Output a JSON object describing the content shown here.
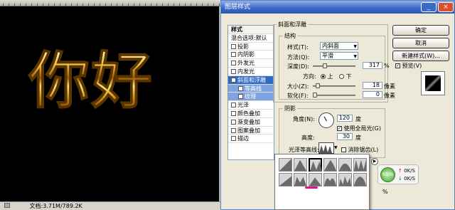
{
  "canvas": {
    "text": "你好",
    "status": "文档:3.71M/789.2K"
  },
  "dialog": {
    "title": "图层样式",
    "left_list": [
      {
        "label": "样式",
        "checkbox": false,
        "style": "header"
      },
      {
        "label": "混合选项:默认",
        "checkbox": false,
        "style": "normal"
      },
      {
        "label": "投影",
        "checkbox": true,
        "checked": false,
        "style": "normal"
      },
      {
        "label": "内阴影",
        "checkbox": true,
        "checked": false,
        "style": "normal"
      },
      {
        "label": "外发光",
        "checkbox": true,
        "checked": false,
        "style": "normal"
      },
      {
        "label": "内发光",
        "checkbox": true,
        "checked": false,
        "style": "normal"
      },
      {
        "label": "斜面和浮雕",
        "checkbox": true,
        "checked": true,
        "style": "sel"
      },
      {
        "label": "等高线",
        "checkbox": true,
        "checked": false,
        "style": "sub"
      },
      {
        "label": "纹理",
        "checkbox": true,
        "checked": false,
        "style": "sub"
      },
      {
        "label": "光泽",
        "checkbox": true,
        "checked": false,
        "style": "normal"
      },
      {
        "label": "颜色叠加",
        "checkbox": true,
        "checked": false,
        "style": "normal"
      },
      {
        "label": "渐变叠加",
        "checkbox": true,
        "checked": false,
        "style": "normal"
      },
      {
        "label": "图案叠加",
        "checkbox": true,
        "checked": false,
        "style": "normal"
      },
      {
        "label": "描边",
        "checkbox": true,
        "checked": false,
        "style": "normal"
      }
    ],
    "bevel": {
      "group_title": "斜面和浮雕",
      "structure_title": "结构",
      "style_label": "样式(T):",
      "style_value": "内斜面",
      "method_label": "方法(Q):",
      "method_value": "平滑",
      "depth_label": "深度(D):",
      "depth_value": "317",
      "depth_unit": "%",
      "direction_label": "方向:",
      "dir_up": "上",
      "dir_down": "下",
      "size_label": "大小(Z):",
      "size_value": "18",
      "size_unit": "像素",
      "soften_label": "软化(F):",
      "soften_value": "0",
      "soften_unit": "像素"
    },
    "shading": {
      "title": "阴影",
      "angle_label": "角度(N):",
      "angle_value": "120",
      "angle_unit": "度",
      "global_light_label": "使用全局光(G)",
      "altitude_label": "高度:",
      "altitude_value": "30",
      "altitude_unit": "度",
      "gloss_label": "光泽等高线:",
      "antialias_label": "消除锯齿(L)"
    },
    "buttons": {
      "ok": "确定",
      "cancel": "取消",
      "new_style": "新建样式(W)...",
      "preview": "预览(V)"
    },
    "partial_percent": "%"
  },
  "speed_widget": {
    "percent": "65%",
    "up": "0K/S",
    "down": "0K/S"
  }
}
